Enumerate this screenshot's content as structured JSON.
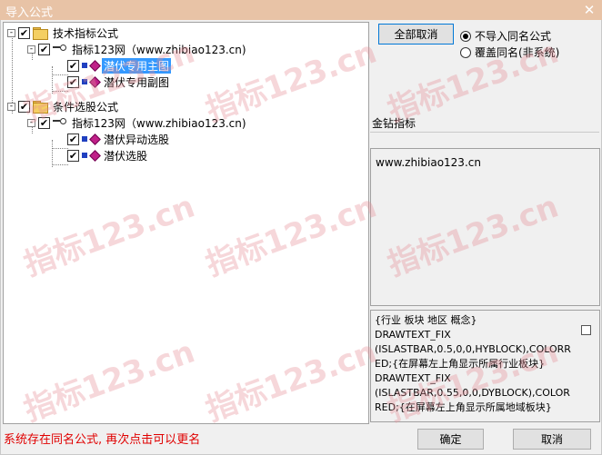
{
  "window": {
    "title": "导入公式",
    "close_glyph": "✕"
  },
  "tree": {
    "nodes": [
      {
        "label": "技术指标公式",
        "checked": true,
        "expander": "-"
      },
      {
        "label": "指标123网（www.zhibiao123.cn)",
        "checked": true,
        "expander": "-"
      },
      {
        "label": "潜伏专用主图",
        "checked": true,
        "selected": true
      },
      {
        "label": "潜伏专用副图",
        "checked": true
      },
      {
        "label": "条件选股公式",
        "checked": true,
        "expander": "-"
      },
      {
        "label": "指标123网（www.zhibiao123.cn)",
        "checked": true,
        "expander": "-"
      },
      {
        "label": "潜伏异动选股",
        "checked": true
      },
      {
        "label": "潜伏选股",
        "checked": true
      }
    ]
  },
  "buttons": {
    "cancel_all": "全部取消",
    "ok": "确定",
    "cancel": "取消"
  },
  "options": {
    "no_import": "不导入同名公式",
    "overwrite": "覆盖同名(非系统)",
    "selected": "no_import"
  },
  "detail": {
    "name": "金钻指标",
    "url": "www.zhibiao123.cn",
    "code": "{行业 板块 地区 概念}\nDRAWTEXT_FIX\n(ISLASTBAR,0.5,0,0,HYBLOCK),COLORRED;{在屏幕左上角显示所属行业板块}\nDRAWTEXT_FIX\n(ISLASTBAR,0.55,0,0,DYBLOCK),COLORRED;{在屏幕左上角显示所属地域板块}"
  },
  "status": {
    "message": "系统存在同名公式, 再次点击可以更名"
  },
  "watermark": {
    "text": "指标123.cn"
  },
  "colors": {
    "titlebar": "#e8c3a6",
    "selection": "#3399ff",
    "status_text": "#e00000"
  }
}
